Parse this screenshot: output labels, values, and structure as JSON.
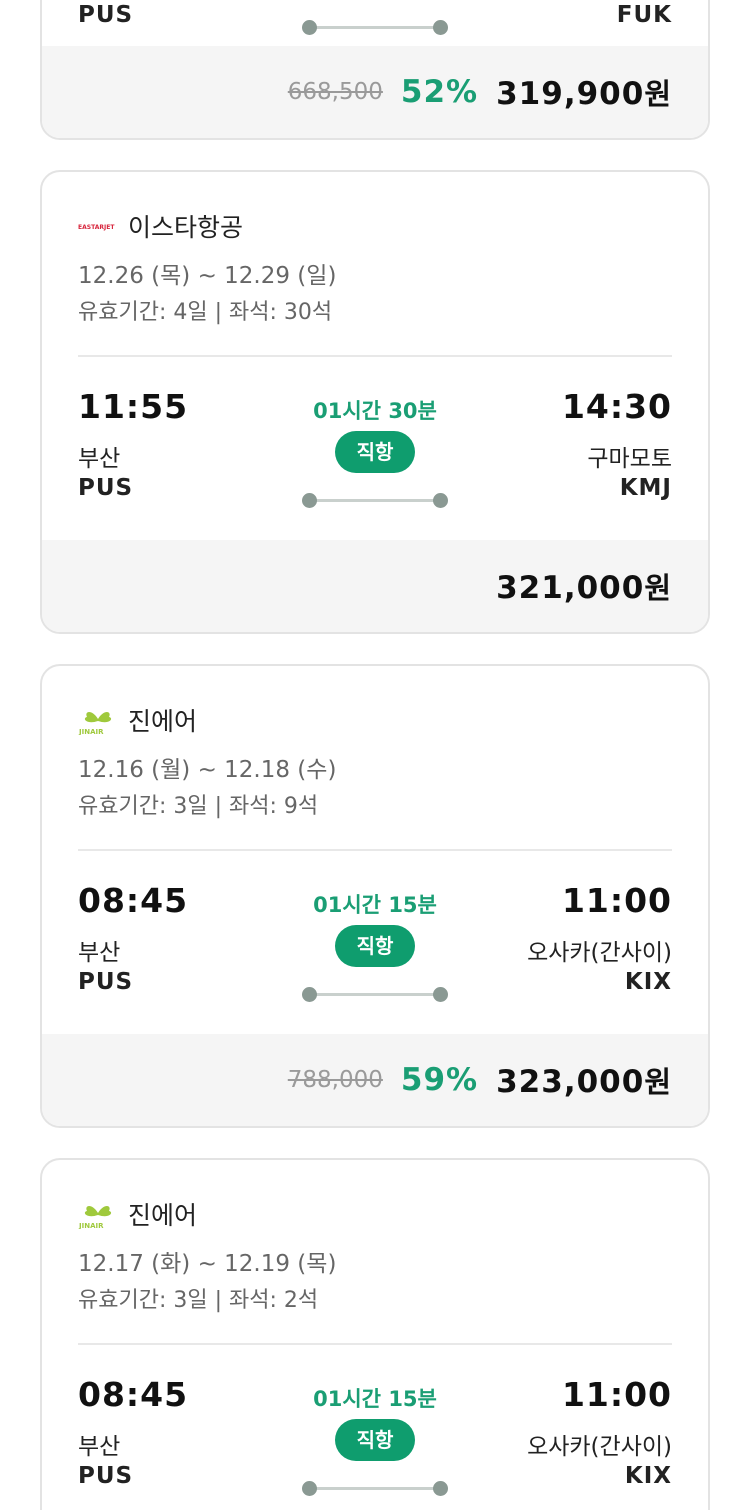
{
  "top_card": {
    "dep_code": "PUS",
    "arr_code": "FUK",
    "original_price": "668,500",
    "discount": "52%",
    "price": "319,900",
    "currency": "원"
  },
  "cards": [
    {
      "airline": "이스타항공",
      "logo_icon": "eastar-jet-logo-icon",
      "logo_text": "EASTAR JET",
      "dates": "12.26 (목) ~ 12.29 (일)",
      "validity": "유효기간: 4일 | 좌석: 30석",
      "dep_time": "11:55",
      "dep_city": "부산",
      "dep_code": "PUS",
      "duration": "01시간 30분",
      "direct_label": "직항",
      "arr_time": "14:30",
      "arr_city": "구마모토",
      "arr_code": "KMJ",
      "original_price": "",
      "discount": "",
      "price": "321,000",
      "currency": "원"
    },
    {
      "airline": "진에어",
      "logo_icon": "jinair-logo-icon",
      "logo_text": "JINAIR",
      "dates": "12.16 (월) ~ 12.18 (수)",
      "validity": "유효기간: 3일 | 좌석: 9석",
      "dep_time": "08:45",
      "dep_city": "부산",
      "dep_code": "PUS",
      "duration": "01시간 15분",
      "direct_label": "직항",
      "arr_time": "11:00",
      "arr_city": "오사카(간사이)",
      "arr_code": "KIX",
      "original_price": "788,000",
      "discount": "59%",
      "price": "323,000",
      "currency": "원"
    },
    {
      "airline": "진에어",
      "logo_icon": "jinair-logo-icon",
      "logo_text": "JINAIR",
      "dates": "12.17 (화) ~ 12.19 (목)",
      "validity": "유효기간: 3일 | 좌석: 2석",
      "dep_time": "08:45",
      "dep_city": "부산",
      "dep_code": "PUS",
      "duration": "01시간 15분",
      "direct_label": "직항",
      "arr_time": "11:00",
      "arr_city": "오사카(간사이)",
      "arr_code": "KIX"
    }
  ],
  "colors": {
    "accent_green": "#1a9e74",
    "badge_green": "#0f9d6e",
    "jinair_lime": "#9fc93c",
    "eastar_red": "#d7263d"
  }
}
